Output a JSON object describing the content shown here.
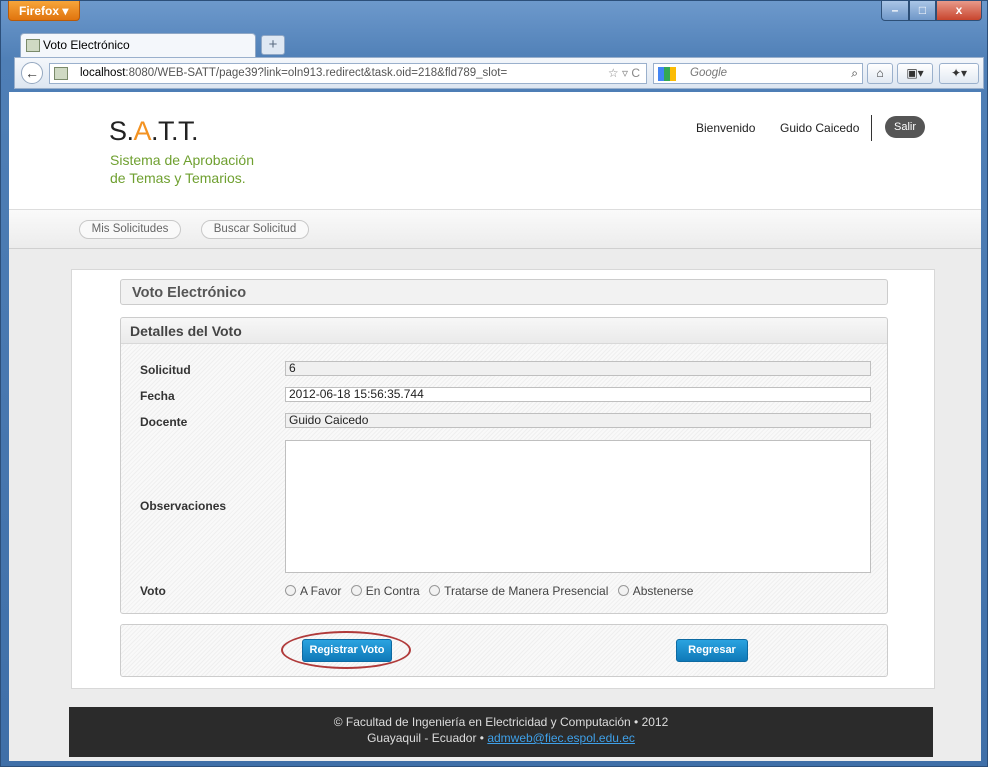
{
  "browser": {
    "menu_button": "Firefox ▾",
    "tab_title": "Voto Electrónico",
    "new_tab": "+",
    "back": "←",
    "url_host": "localhost",
    "url_rest": ":8080/WEB-SATT/page39?link=oln913.redirect&task.oid=218&fld789_slot=",
    "url_icons": "☆ ▿ C",
    "search_engine": "Google",
    "search_icon": "⌕",
    "home_icon": "⌂",
    "bookmark_icon": "▣▾",
    "addon_icon": "✦▾",
    "window_min": "–",
    "window_max": "□",
    "window_close": "x"
  },
  "header": {
    "logo_s": "S.",
    "logo_a": "A",
    "logo_rest": ".T.T.",
    "tagline_line1": "Sistema de Aprobación",
    "tagline_line2": "de Temas y Temarios.",
    "welcome": "Bienvenido",
    "user_name": "Guido Caicedo",
    "logout": "Salir"
  },
  "menu": {
    "items": [
      {
        "label": "Mis Solicitudes"
      },
      {
        "label": "Buscar Solicitud"
      }
    ]
  },
  "page": {
    "section_title": "Voto Electrónico",
    "panel_title": "Detalles del Voto",
    "fields": {
      "solicitud_label": "Solicitud",
      "solicitud_value": "6",
      "fecha_label": "Fecha",
      "fecha_value": "2012-06-18 15:56:35.744",
      "docente_label": "Docente",
      "docente_value": "Guido Caicedo",
      "observaciones_label": "Observaciones",
      "voto_label": "Voto"
    },
    "vote_options": [
      "A Favor",
      "En Contra",
      "Tratarse de Manera Presencial",
      "Abstenerse"
    ],
    "register_button": "Registrar Voto",
    "back_button": "Regresar"
  },
  "footer": {
    "line1": "© Facultad de Ingeniería en Electricidad y Computación • 2012",
    "line2_prefix": "Guayaquil - Ecuador • ",
    "email": "admweb@fiec.espol.edu.ec"
  },
  "colors": {
    "accent_orange": "#f39221",
    "tagline_green": "#6fa030",
    "button_blue": "#1a8fd0",
    "highlight_ring": "#b03a3a"
  }
}
